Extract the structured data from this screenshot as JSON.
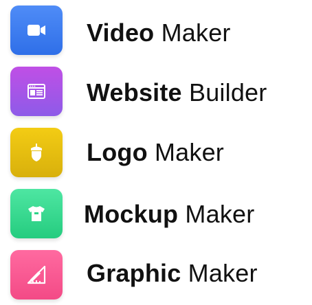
{
  "items": [
    {
      "bold": "Video",
      "light": "Maker",
      "icon": "video-camera-icon",
      "color": "#3b7cf0"
    },
    {
      "bold": "Website",
      "light": "Builder",
      "icon": "browser-window-icon",
      "color": "#a65ae8"
    },
    {
      "bold": "Logo",
      "light": "Maker",
      "icon": "acorn-icon",
      "color": "#e6bd10"
    },
    {
      "bold": "Mockup",
      "light": "Maker",
      "icon": "tshirt-icon",
      "color": "#34d88e"
    },
    {
      "bold": "Graphic",
      "light": "Maker",
      "icon": "pencil-ruler-icon",
      "color": "#f75a92"
    }
  ]
}
